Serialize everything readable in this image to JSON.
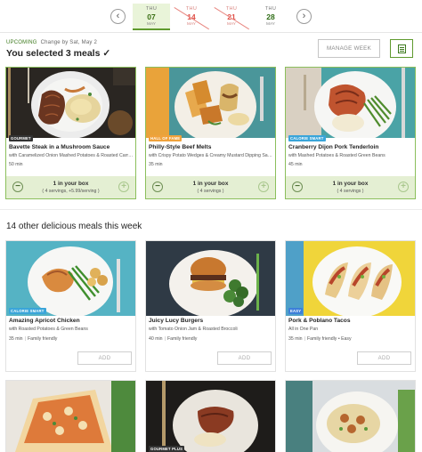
{
  "colors": {
    "accent": "#5f9a2e",
    "selected_bg": "#e4efd3",
    "skipped": "#e0524a",
    "badge_gourmet": "#333333",
    "badge_fans": "#f0a23b",
    "badge_calorie": "#3aa5d9",
    "badge_easy": "#3d7fd9"
  },
  "nav": {
    "prev_icon": "chevron-left-icon",
    "next_icon": "chevron-right-icon",
    "prev_glyph": "‹",
    "next_glyph": "›"
  },
  "weeks": [
    {
      "dow": "THU",
      "day": "07",
      "month": "MAY",
      "state": "active"
    },
    {
      "dow": "THU",
      "day": "14",
      "month": "MAY",
      "state": "skipped"
    },
    {
      "dow": "THU",
      "day": "21",
      "month": "MAY",
      "state": "skipped"
    },
    {
      "dow": "THU",
      "day": "28",
      "month": "MAY",
      "state": "plain"
    }
  ],
  "upcoming": {
    "tag": "Upcoming",
    "change_by": "Change by Sat, May 2"
  },
  "selected_title": "You selected 3 meals ✓",
  "manage_week_label": "MANAGE WEEK",
  "menu_icon": "document-icon",
  "selected_meals": [
    {
      "badge": "GOURMET",
      "title": "Bavette Steak in a Mushroom Sauce",
      "subtitle": "with Caramelized Onion Mashed Potatoes & Roasted Carr…",
      "time": "50 min",
      "in_box": "1 in your box",
      "servings": "( 4 servings, +5.99/serving )"
    },
    {
      "badge": "HALL OF FAME",
      "title": "Philly-Style Beef Melts",
      "subtitle": "with Crispy Potato Wedges & Creamy Mustard Dipping Sa…",
      "time": "35 min",
      "in_box": "1 in your box",
      "servings": "( 4 servings )"
    },
    {
      "badge": "CALORIE SMART",
      "title": "Cranberry Dijon Pork Tenderloin",
      "subtitle": "with Mashed Potatoes & Roasted Green Beans",
      "time": "45 min",
      "in_box": "1 in your box",
      "servings": "( 4 servings )"
    }
  ],
  "other_title": "14 other delicious meals this week",
  "other_meals": [
    {
      "badge": "CALORIE SMART",
      "title": "Amazing Apricot Chicken",
      "subtitle": "with Roasted Potatoes & Green Beans",
      "time": "35 min",
      "tags": "Family friendly",
      "add": "ADD"
    },
    {
      "badge": "",
      "title": "Juicy Lucy Burgers",
      "subtitle": "with Tomato Onion Jam & Roasted Broccoli",
      "time": "40 min",
      "tags": "Family friendly",
      "add": "ADD"
    },
    {
      "badge": "EASY",
      "title": "Pork & Poblano Tacos",
      "subtitle": "All in One Pan",
      "time": "35 min",
      "tags": "Family friendly • Easy",
      "add": "ADD"
    }
  ],
  "row3_badge": "GOURMET PLUS"
}
